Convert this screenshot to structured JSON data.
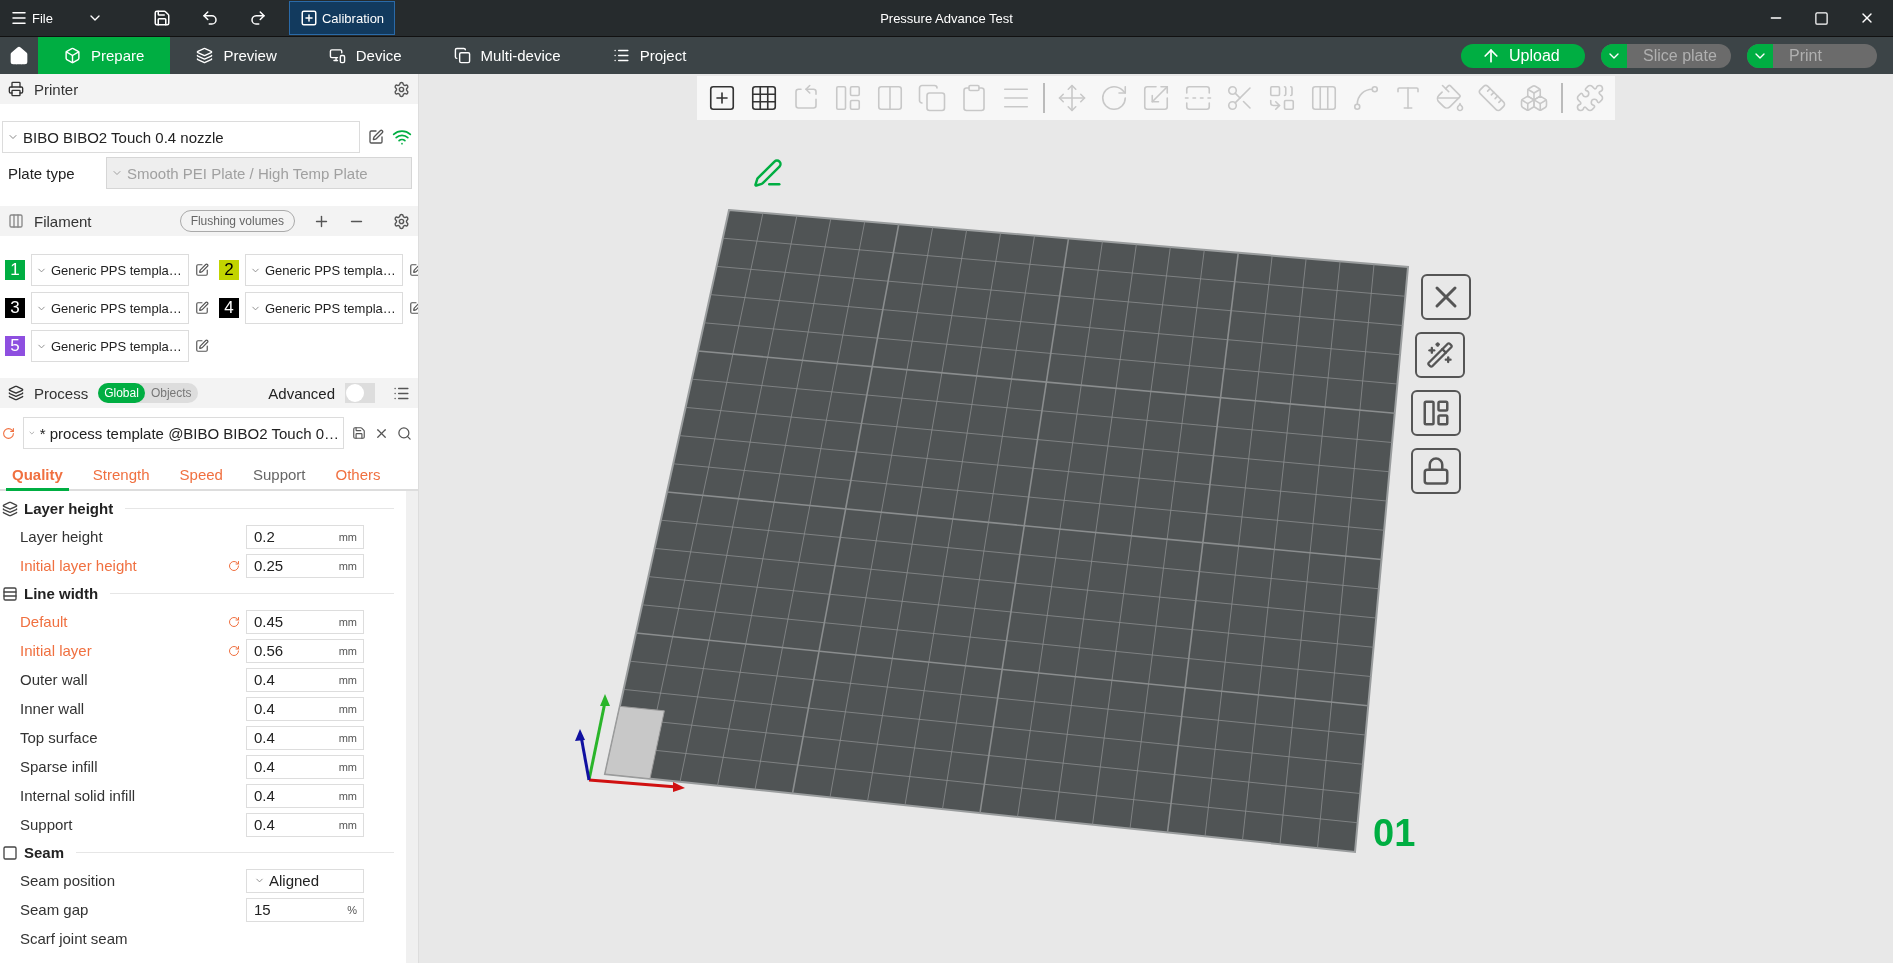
{
  "title_bar": {
    "menu": "File",
    "calibration": "Calibration",
    "title": "Pressure Advance Test"
  },
  "nav_tabs": [
    {
      "label": "Prepare",
      "kind": "prepare",
      "selected": true
    },
    {
      "label": "Preview",
      "kind": "preview",
      "selected": false
    },
    {
      "label": "Device",
      "kind": "device",
      "selected": false
    },
    {
      "label": "Multi-device",
      "kind": "multi",
      "selected": false
    },
    {
      "label": "Project",
      "kind": "project",
      "selected": false
    }
  ],
  "actions": [
    {
      "label": "Upload",
      "kind": "upload",
      "disabled": false
    },
    {
      "label": "Slice plate",
      "kind": "split",
      "disabled": true
    },
    {
      "label": "Print",
      "kind": "split",
      "disabled": true
    }
  ],
  "printer": {
    "title": "Printer",
    "preset": "BIBO BIBO2 Touch 0.4 nozzle",
    "plate_type_label": "Plate type",
    "plate_type": "Smooth PEI Plate / High Temp Plate"
  },
  "filament": {
    "title": "Filament",
    "flushing_button": "Flushing volumes",
    "slots": [
      {
        "number": "1",
        "color": "#00ae42",
        "preset": "Generic PPS templa…"
      },
      {
        "number": "2",
        "color": "#c2d400",
        "preset": "Generic PPS templa…"
      },
      {
        "number": "3",
        "color": "#000000",
        "preset": "Generic PPS templa…"
      },
      {
        "number": "4",
        "color": "#000000",
        "preset": "Generic PPS templa…"
      },
      {
        "number": "5",
        "color": "#8e4fe0",
        "preset": "Generic PPS templa…"
      }
    ]
  },
  "process": {
    "title": "Process",
    "scope": [
      {
        "label": "Global",
        "selected": true
      },
      {
        "label": "Objects",
        "selected": false
      }
    ],
    "advanced_label": "Advanced",
    "advanced": false,
    "preset": "* process template @BIBO BIBO2 Touch 0…",
    "tabs": [
      {
        "label": "Quality",
        "selected": true,
        "modified": true
      },
      {
        "label": "Strength",
        "selected": false,
        "modified": true
      },
      {
        "label": "Speed",
        "selected": false,
        "modified": true
      },
      {
        "label": "Support",
        "selected": false,
        "modified": false
      },
      {
        "label": "Others",
        "selected": false,
        "modified": true
      }
    ]
  },
  "groups": [
    {
      "title": "Layer height",
      "kind": "layers",
      "settings": [
        {
          "label": "Layer height",
          "kind": "number",
          "value": "0.2",
          "unit": "mm",
          "modified": false
        },
        {
          "label": "Initial layer height",
          "kind": "number",
          "value": "0.25",
          "unit": "mm",
          "modified": true
        }
      ]
    },
    {
      "title": "Line width",
      "kind": "width",
      "settings": [
        {
          "label": "Default",
          "kind": "number",
          "value": "0.45",
          "unit": "mm",
          "modified": true
        },
        {
          "label": "Initial layer",
          "kind": "number",
          "value": "0.56",
          "unit": "mm",
          "modified": true
        },
        {
          "label": "Outer wall",
          "kind": "number",
          "value": "0.4",
          "unit": "mm",
          "modified": false
        },
        {
          "label": "Inner wall",
          "kind": "number",
          "value": "0.4",
          "unit": "mm",
          "modified": false
        },
        {
          "label": "Top surface",
          "kind": "number",
          "value": "0.4",
          "unit": "mm",
          "modified": false
        },
        {
          "label": "Sparse infill",
          "kind": "number",
          "value": "0.4",
          "unit": "mm",
          "modified": false
        },
        {
          "label": "Internal solid infill",
          "kind": "number",
          "value": "0.4",
          "unit": "mm",
          "modified": false
        },
        {
          "label": "Support",
          "kind": "number",
          "value": "0.4",
          "unit": "mm",
          "modified": false
        }
      ]
    },
    {
      "title": "Seam",
      "kind": "seam",
      "settings": [
        {
          "label": "Seam position",
          "kind": "dropdown",
          "value": "Aligned",
          "modified": false
        },
        {
          "label": "Seam gap",
          "kind": "number",
          "value": "15",
          "unit": "%",
          "modified": false
        },
        {
          "label": "Scarf joint seam",
          "kind": "cut",
          "modified": false
        }
      ]
    }
  ],
  "toolbar": [
    {
      "kind": "add",
      "disabled": false
    },
    {
      "kind": "plate",
      "disabled": false
    },
    {
      "kind": "orient",
      "disabled": true
    },
    {
      "kind": "arrange",
      "disabled": true
    },
    {
      "kind": "split",
      "disabled": true
    },
    {
      "kind": "copy",
      "disabled": true
    },
    {
      "kind": "paste",
      "disabled": true
    },
    {
      "kind": "layers",
      "disabled": true
    },
    {
      "kind": "sep"
    },
    {
      "kind": "move",
      "disabled": true
    },
    {
      "kind": "rotate",
      "disabled": true
    },
    {
      "kind": "scale",
      "disabled": true
    },
    {
      "kind": "lay",
      "disabled": true
    },
    {
      "kind": "cut",
      "disabled": true
    },
    {
      "kind": "boolean",
      "disabled": true
    },
    {
      "kind": "support",
      "disabled": true
    },
    {
      "kind": "seam",
      "disabled": true
    },
    {
      "kind": "text",
      "disabled": true
    },
    {
      "kind": "paint",
      "disabled": true
    },
    {
      "kind": "measure",
      "disabled": true
    },
    {
      "kind": "assembly",
      "disabled": true
    },
    {
      "kind": "sep"
    },
    {
      "kind": "explode",
      "disabled": true
    }
  ],
  "plate_label": "01"
}
